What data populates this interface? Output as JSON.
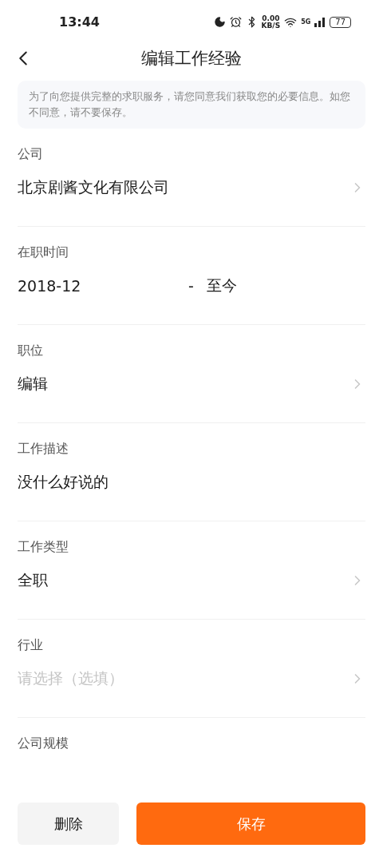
{
  "status_bar": {
    "time": "13:44",
    "net_speed": "0.00",
    "net_unit": "KB/S",
    "network": "5G",
    "battery": "77"
  },
  "header": {
    "title": "编辑工作经验"
  },
  "notice": "为了向您提供完整的求职服务，请您同意我们获取您的必要信息。如您不同意，请不要保存。",
  "fields": [
    {
      "kind": "select",
      "label": "公司",
      "value": "北京剧酱文化有限公司"
    },
    {
      "kind": "range",
      "label": "在职时间",
      "start": "2018-12",
      "separator": "-",
      "end": "至今"
    },
    {
      "kind": "select",
      "label": "职位",
      "value": "编辑"
    },
    {
      "kind": "text",
      "label": "工作描述",
      "value": "没什么好说的"
    },
    {
      "kind": "select",
      "label": "工作类型",
      "value": "全职"
    },
    {
      "kind": "select",
      "label": "行业",
      "placeholder": "请选择（选填）"
    },
    {
      "kind": "label",
      "label": "公司规模"
    }
  ],
  "buttons": {
    "delete": "删除",
    "save": "保存"
  }
}
